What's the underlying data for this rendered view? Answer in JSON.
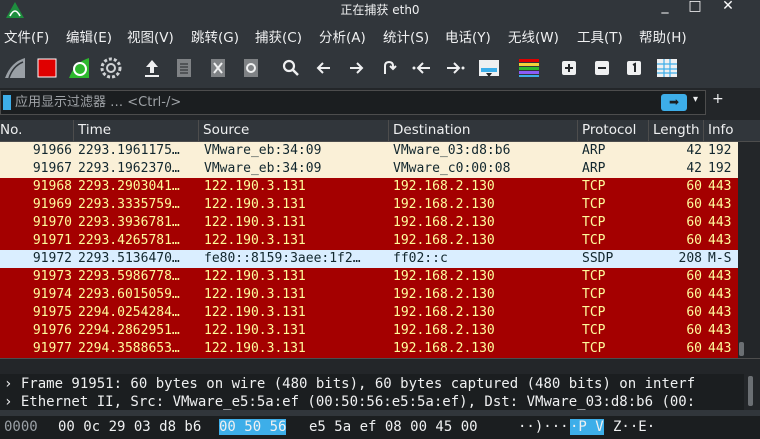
{
  "window": {
    "title": "正在捕获 eth0",
    "minimize": "_",
    "maximize": "□",
    "close": "✕"
  },
  "menu": [
    "文件(F)",
    "编辑(E)",
    "视图(V)",
    "跳转(G)",
    "捕获(C)",
    "分析(A)",
    "统计(S)",
    "电话(Y)",
    "无线(W)",
    "工具(T)",
    "帮助(H)"
  ],
  "filter": {
    "placeholder": "应用显示过滤器 … <Ctrl-/>",
    "apply": "➡",
    "dropdown": "▾",
    "add": "+"
  },
  "columns": [
    "No.",
    "Time",
    "Source",
    "Destination",
    "Protocol",
    "Length",
    "Info"
  ],
  "colors": {
    "arp_bg": "#faf0d7",
    "arp_fg": "#12272e",
    "tcp_bg": "#a40000",
    "tcp_fg": "#fffc9c",
    "ssdp_bg": "#daeeff",
    "ssdp_fg": "#12272e"
  },
  "packets": [
    {
      "no": "91966",
      "time": "2293.1961175…",
      "src": "VMware_eb:34:09",
      "dst": "VMware_03:d8:b6",
      "proto": "ARP",
      "len": "42",
      "info": "192",
      "kind": "arp"
    },
    {
      "no": "91967",
      "time": "2293.1962370…",
      "src": "VMware_eb:34:09",
      "dst": "VMware_c0:00:08",
      "proto": "ARP",
      "len": "42",
      "info": "192",
      "kind": "arp"
    },
    {
      "no": "91968",
      "time": "2293.2903041…",
      "src": "122.190.3.131",
      "dst": "192.168.2.130",
      "proto": "TCP",
      "len": "60",
      "info": "443",
      "kind": "tcp"
    },
    {
      "no": "91969",
      "time": "2293.3335759…",
      "src": "122.190.3.131",
      "dst": "192.168.2.130",
      "proto": "TCP",
      "len": "60",
      "info": "443",
      "kind": "tcp"
    },
    {
      "no": "91970",
      "time": "2293.3936781…",
      "src": "122.190.3.131",
      "dst": "192.168.2.130",
      "proto": "TCP",
      "len": "60",
      "info": "443",
      "kind": "tcp"
    },
    {
      "no": "91971",
      "time": "2293.4265781…",
      "src": "122.190.3.131",
      "dst": "192.168.2.130",
      "proto": "TCP",
      "len": "60",
      "info": "443",
      "kind": "tcp"
    },
    {
      "no": "91972",
      "time": "2293.5136470…",
      "src": "fe80::8159:3aee:1f2…",
      "dst": "ff02::c",
      "proto": "SSDP",
      "len": "208",
      "info": "M-S",
      "kind": "ssdp"
    },
    {
      "no": "91973",
      "time": "2293.5986778…",
      "src": "122.190.3.131",
      "dst": "192.168.2.130",
      "proto": "TCP",
      "len": "60",
      "info": "443",
      "kind": "tcp"
    },
    {
      "no": "91974",
      "time": "2293.6015059…",
      "src": "122.190.3.131",
      "dst": "192.168.2.130",
      "proto": "TCP",
      "len": "60",
      "info": "443",
      "kind": "tcp"
    },
    {
      "no": "91975",
      "time": "2294.0254284…",
      "src": "122.190.3.131",
      "dst": "192.168.2.130",
      "proto": "TCP",
      "len": "60",
      "info": "443",
      "kind": "tcp"
    },
    {
      "no": "91976",
      "time": "2294.2862951…",
      "src": "122.190.3.131",
      "dst": "192.168.2.130",
      "proto": "TCP",
      "len": "60",
      "info": "443",
      "kind": "tcp"
    },
    {
      "no": "91977",
      "time": "2294.3588653…",
      "src": "122.190.3.131",
      "dst": "192.168.2.130",
      "proto": "TCP",
      "len": "60",
      "info": "443",
      "kind": "tcp"
    }
  ],
  "details": [
    "› Frame 91951: 60 bytes on wire (480 bits), 60 bytes captured (480 bits) on interf",
    "› Ethernet II, Src: VMware_e5:5a:ef (00:50:56:e5:5a:ef), Dst: VMware_03:d8:b6 (00:"
  ],
  "bytes": {
    "offset": "0000",
    "pre": "00 0c 29 03 d8 b6",
    "highlight": "00 50  56",
    "post": "e5 5a ef 08 00 45 00",
    "ascii_pre": "··)···",
    "ascii_hl": "·P V",
    "ascii_post": "Z··E·"
  }
}
